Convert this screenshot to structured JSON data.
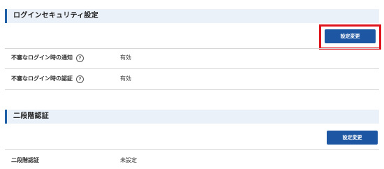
{
  "login_security": {
    "title": "ログインセキュリティ設定",
    "change_button": "設定変更",
    "rows": [
      {
        "label": "不審なログイン時の通知",
        "help": "?",
        "value": "有効"
      },
      {
        "label": "不審なログイン時の認証",
        "help": "?",
        "value": "有効"
      }
    ]
  },
  "two_step": {
    "title": "二段階認証",
    "change_button": "設定変更",
    "rows": [
      {
        "label": "二段階認証",
        "value": "未設定"
      }
    ]
  },
  "colors": {
    "header_background": "#eaf1f8",
    "accent_blue": "#1d56a2",
    "highlight_red": "#e0141c"
  }
}
